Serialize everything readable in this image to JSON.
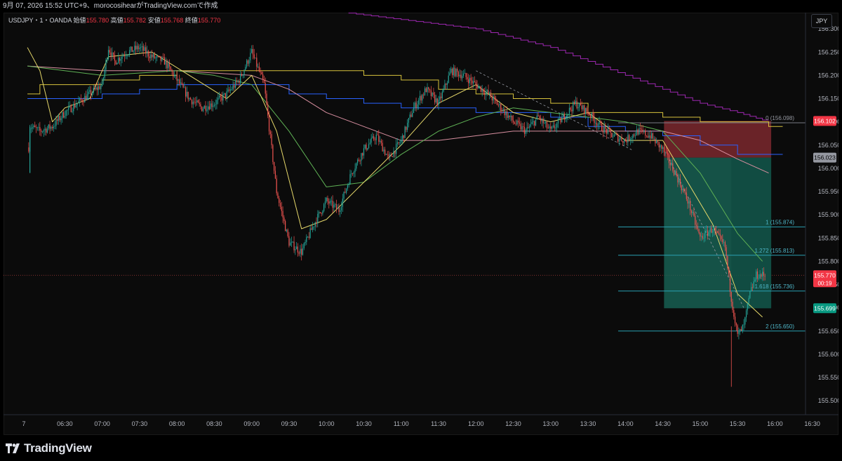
{
  "header": {
    "text": "9月 07, 2026 15:52 UTC+9、morocosihearがTradingView.comで作成"
  },
  "legend": {
    "symbol": "USDJPY・1・OANDA",
    "open_label": "始値",
    "open": "155.780",
    "high_label": "高値",
    "high": "155.782",
    "low_label": "安値",
    "low": "155.768",
    "close_label": "終値",
    "close": "155.770"
  },
  "currency_button": "JPY",
  "brand": {
    "name": "TradingView"
  },
  "colors": {
    "up": "#26a69a",
    "down": "#ef5350",
    "background": "#0b0b0b",
    "ma_yellow": "#e6d86a",
    "ma_green": "#5fb155",
    "ma_pink": "#d88fa0",
    "ichimoku_blue": "#2962ff",
    "ichimoku_yellow": "#d7c23c",
    "envelope_purple": "#9c27b0",
    "fib_line": "#2a9fb2",
    "short_stop": "#8b2c33",
    "short_target": "#1a6b5c"
  },
  "chart_data": {
    "type": "candlestick",
    "symbol": "USDJPY",
    "timeframe": "1",
    "x_ticks": [
      "7",
      "06:30",
      "07:00",
      "07:30",
      "08:00",
      "08:30",
      "09:00",
      "09:30",
      "10:00",
      "10:30",
      "11:00",
      "11:30",
      "12:00",
      "12:30",
      "13:00",
      "13:30",
      "14:00",
      "14:30",
      "15:00",
      "15:30",
      "16:00",
      "16:30"
    ],
    "y_ticks": [
      "156.300",
      "156.250",
      "156.200",
      "156.150",
      "156.100",
      "156.050",
      "156.000",
      "155.950",
      "155.900",
      "155.850",
      "155.800",
      "155.750",
      "155.700",
      "155.650",
      "155.600",
      "155.550",
      "155.500"
    ],
    "ylim": [
      155.47,
      156.335
    ],
    "price_path": [
      [
        "06:00",
        156.0
      ],
      [
        "06:02",
        156.09
      ],
      [
        "06:10",
        156.08
      ],
      [
        "06:20",
        156.09
      ],
      [
        "06:30",
        156.12
      ],
      [
        "06:40",
        156.14
      ],
      [
        "06:50",
        156.16
      ],
      [
        "07:00",
        156.18
      ],
      [
        "07:05",
        156.26
      ],
      [
        "07:10",
        156.23
      ],
      [
        "07:20",
        156.25
      ],
      [
        "07:30",
        156.26
      ],
      [
        "07:40",
        156.24
      ],
      [
        "07:50",
        156.23
      ],
      [
        "08:00",
        156.19
      ],
      [
        "08:10",
        156.15
      ],
      [
        "08:20",
        156.13
      ],
      [
        "08:30",
        156.14
      ],
      [
        "08:40",
        156.16
      ],
      [
        "08:50",
        156.19
      ],
      [
        "09:00",
        156.25
      ],
      [
        "09:10",
        156.18
      ],
      [
        "09:20",
        155.95
      ],
      [
        "09:30",
        155.84
      ],
      [
        "09:40",
        155.82
      ],
      [
        "09:50",
        155.88
      ],
      [
        "10:00",
        155.93
      ],
      [
        "10:10",
        155.91
      ],
      [
        "10:20",
        155.99
      ],
      [
        "10:30",
        156.04
      ],
      [
        "10:40",
        156.07
      ],
      [
        "10:50",
        156.02
      ],
      [
        "11:00",
        156.06
      ],
      [
        "11:10",
        156.13
      ],
      [
        "11:20",
        156.17
      ],
      [
        "11:30",
        156.14
      ],
      [
        "11:40",
        156.21
      ],
      [
        "11:50",
        156.2
      ],
      [
        "12:00",
        156.18
      ],
      [
        "12:10",
        156.16
      ],
      [
        "12:20",
        156.13
      ],
      [
        "12:30",
        156.1
      ],
      [
        "12:40",
        156.08
      ],
      [
        "12:50",
        156.11
      ],
      [
        "13:00",
        156.08
      ],
      [
        "13:10",
        156.11
      ],
      [
        "13:20",
        156.14
      ],
      [
        "13:30",
        156.12
      ],
      [
        "13:40",
        156.09
      ],
      [
        "13:50",
        156.07
      ],
      [
        "14:00",
        156.06
      ],
      [
        "14:10",
        156.08
      ],
      [
        "14:20",
        156.07
      ],
      [
        "14:30",
        156.04
      ],
      [
        "14:40",
        155.99
      ],
      [
        "14:50",
        155.93
      ],
      [
        "15:00",
        155.85
      ],
      [
        "15:10",
        155.87
      ],
      [
        "15:20",
        155.83
      ],
      [
        "15:25",
        155.72
      ],
      [
        "15:30",
        155.64
      ],
      [
        "15:35",
        155.66
      ],
      [
        "15:40",
        155.73
      ],
      [
        "15:45",
        155.77
      ]
    ],
    "last_price": "155.770",
    "countdown": "00:19",
    "price_labels": [
      "156.102",
      "156.023",
      "155.699"
    ],
    "fibonacci_levels": [
      {
        "label": "0 (156.098)",
        "value": 156.098
      },
      {
        "label": "1 (155.874)",
        "value": 155.874
      },
      {
        "label": "1.272 (155.813)",
        "value": 155.813
      },
      {
        "label": "1.618 (155.736)",
        "value": 155.736
      },
      {
        "label": "2 (155.650)",
        "value": 155.65
      }
    ],
    "short_position": {
      "entry": 156.023,
      "stop": 156.102,
      "target": 155.699,
      "start": "14:31",
      "end": "15:57"
    },
    "moving_averages": {
      "yellow": [
        [
          "06:00",
          156.26
        ],
        [
          "06:10",
          156.21
        ],
        [
          "06:20",
          156.1
        ],
        [
          "06:30",
          156.13
        ],
        [
          "06:50",
          156.15
        ],
        [
          "07:05",
          156.24
        ],
        [
          "07:40",
          156.25
        ],
        [
          "08:10",
          156.2
        ],
        [
          "08:40",
          156.15
        ],
        [
          "09:00",
          156.2
        ],
        [
          "09:20",
          156.08
        ],
        [
          "09:40",
          155.87
        ],
        [
          "10:00",
          155.89
        ],
        [
          "10:30",
          155.97
        ],
        [
          "11:00",
          156.05
        ],
        [
          "11:30",
          156.14
        ],
        [
          "12:00",
          156.18
        ],
        [
          "12:30",
          156.12
        ],
        [
          "13:00",
          156.1
        ],
        [
          "13:30",
          156.12
        ],
        [
          "14:00",
          156.06
        ],
        [
          "14:30",
          156.06
        ],
        [
          "14:50",
          155.97
        ],
        [
          "15:10",
          155.88
        ],
        [
          "15:30",
          155.73
        ],
        [
          "15:50",
          155.68
        ]
      ],
      "green": [
        [
          "06:00",
          156.22
        ],
        [
          "07:00",
          156.2
        ],
        [
          "08:00",
          156.21
        ],
        [
          "08:30",
          156.2
        ],
        [
          "09:00",
          156.18
        ],
        [
          "09:30",
          156.08
        ],
        [
          "10:00",
          155.96
        ],
        [
          "10:30",
          155.97
        ],
        [
          "11:00",
          156.03
        ],
        [
          "11:30",
          156.08
        ],
        [
          "12:00",
          156.11
        ],
        [
          "12:30",
          156.13
        ],
        [
          "13:00",
          156.12
        ],
        [
          "13:30",
          156.11
        ],
        [
          "14:00",
          156.1
        ],
        [
          "14:30",
          156.08
        ],
        [
          "15:00",
          155.99
        ],
        [
          "15:30",
          155.86
        ],
        [
          "15:50",
          155.8
        ]
      ],
      "pink": [
        [
          "06:00",
          156.22
        ],
        [
          "07:00",
          156.21
        ],
        [
          "08:00",
          156.21
        ],
        [
          "09:00",
          156.2
        ],
        [
          "09:30",
          156.17
        ],
        [
          "10:00",
          156.12
        ],
        [
          "10:30",
          156.09
        ],
        [
          "11:00",
          156.06
        ],
        [
          "11:30",
          156.06
        ],
        [
          "12:00",
          156.07
        ],
        [
          "12:30",
          156.08
        ],
        [
          "13:00",
          156.08
        ],
        [
          "13:30",
          156.08
        ],
        [
          "14:00",
          156.08
        ],
        [
          "14:30",
          156.08
        ],
        [
          "15:00",
          156.06
        ],
        [
          "15:30",
          156.02
        ],
        [
          "15:55",
          155.99
        ]
      ]
    },
    "ichimoku": {
      "yellow_steps": [
        [
          "06:00",
          156.16
        ],
        [
          "06:10",
          156.18
        ],
        [
          "07:00",
          156.19
        ],
        [
          "07:30",
          156.2
        ],
        [
          "08:00",
          156.21
        ],
        [
          "09:00",
          156.21
        ],
        [
          "09:30",
          156.21
        ],
        [
          "10:30",
          156.2
        ],
        [
          "11:00",
          156.19
        ],
        [
          "11:30",
          156.17
        ],
        [
          "12:00",
          156.16
        ],
        [
          "12:30",
          156.15
        ],
        [
          "13:00",
          156.14
        ],
        [
          "13:30",
          156.12
        ],
        [
          "14:00",
          156.12
        ],
        [
          "14:30",
          156.11
        ],
        [
          "15:00",
          156.1
        ],
        [
          "15:30",
          156.1
        ],
        [
          "15:55",
          156.09
        ]
      ],
      "blue_steps": [
        [
          "06:00",
          156.15
        ],
        [
          "07:00",
          156.16
        ],
        [
          "07:30",
          156.17
        ],
        [
          "08:00",
          156.18
        ],
        [
          "09:00",
          156.18
        ],
        [
          "09:30",
          156.16
        ],
        [
          "10:00",
          156.15
        ],
        [
          "10:30",
          156.14
        ],
        [
          "11:00",
          156.13
        ],
        [
          "12:00",
          156.12
        ],
        [
          "12:30",
          156.12
        ],
        [
          "13:00",
          156.11
        ],
        [
          "13:30",
          156.09
        ],
        [
          "14:00",
          156.08
        ],
        [
          "14:30",
          156.07
        ],
        [
          "15:00",
          156.05
        ],
        [
          "15:30",
          156.03
        ],
        [
          "15:55",
          156.03
        ]
      ],
      "purple_steps": [
        [
          "09:00",
          156.36
        ],
        [
          "09:30",
          156.35
        ],
        [
          "10:00",
          156.34
        ],
        [
          "10:30",
          156.33
        ],
        [
          "11:00",
          156.32
        ],
        [
          "11:30",
          156.31
        ],
        [
          "12:00",
          156.3
        ],
        [
          "12:30",
          156.28
        ],
        [
          "13:00",
          156.26
        ],
        [
          "13:30",
          156.23
        ],
        [
          "14:00",
          156.2
        ],
        [
          "14:30",
          156.17
        ],
        [
          "15:00",
          156.14
        ],
        [
          "15:30",
          156.12
        ],
        [
          "15:55",
          156.1
        ]
      ]
    },
    "trend_lines": [
      {
        "from": [
          "12:00",
          156.21
        ],
        "to": [
          "14:05",
          156.04
        ]
      },
      {
        "from": [
          "14:35",
          156.02
        ],
        "to": [
          "15:35",
          155.7
        ]
      }
    ]
  }
}
